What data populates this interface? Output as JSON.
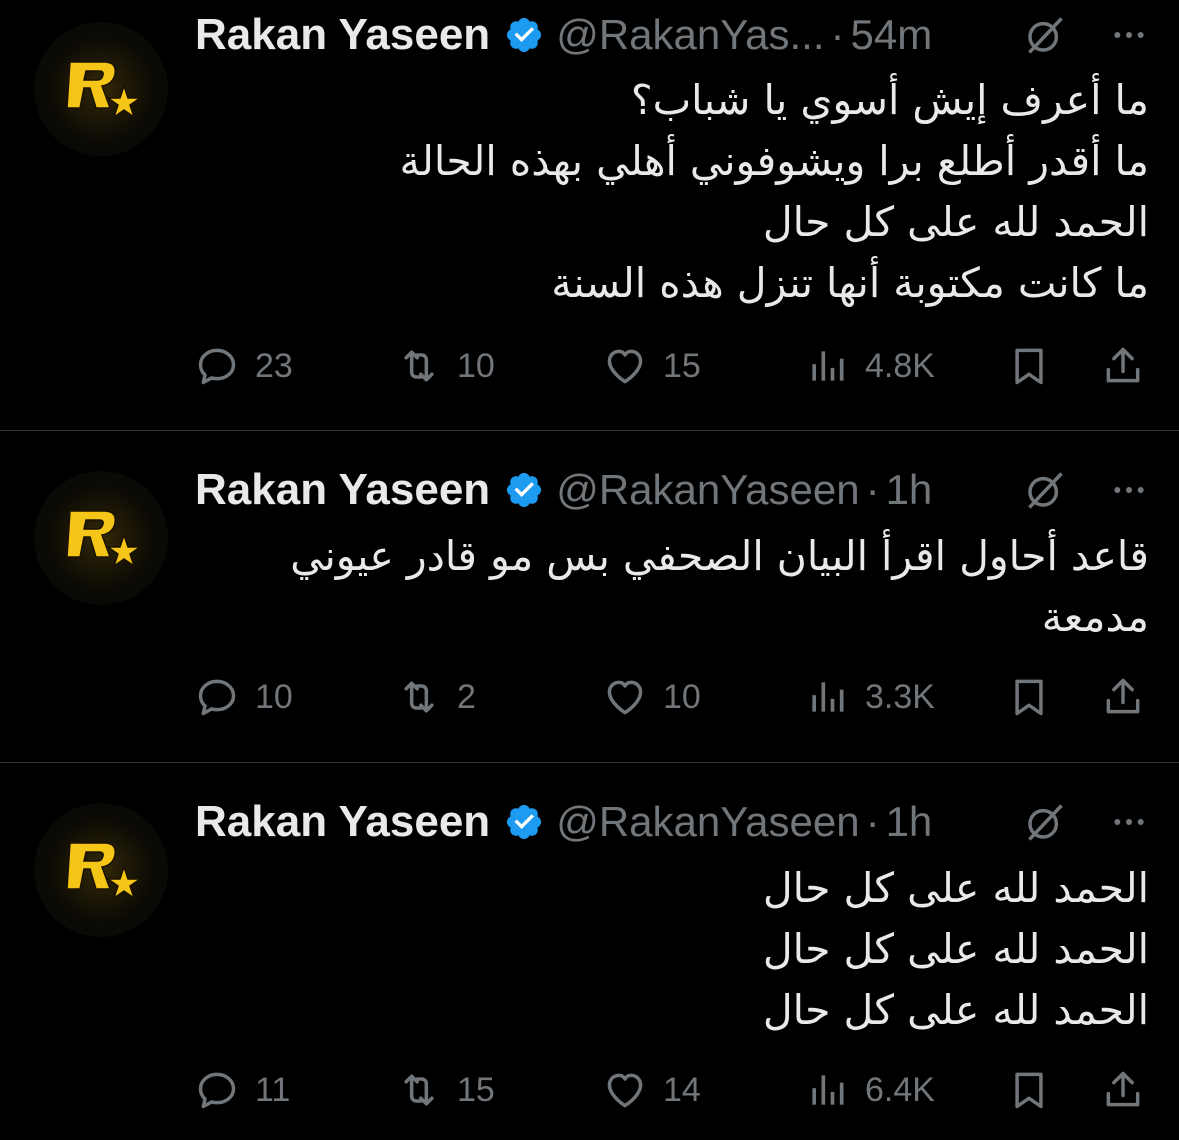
{
  "tweets": [
    {
      "author_name": "Rakan Yaseen",
      "handle": "@RakanYas...",
      "separator": "·",
      "time": "54m",
      "lines": [
        "ما أعرف إيش أسوي يا شباب؟",
        "ما أقدر أطلع برا ويشوفوني أهلي بهذه الحالة",
        "الحمد لله على كل حال",
        "ما كانت مكتوبة أنها تنزل هذه السنة"
      ],
      "replies": "23",
      "reposts": "10",
      "likes": "15",
      "views": "4.8K"
    },
    {
      "author_name": "Rakan Yaseen",
      "handle": "@RakanYaseen",
      "separator": "·",
      "time": "1h",
      "lines": [
        "قاعد أحاول اقرأ البيان الصحفي بس مو قادر عيوني",
        "مدمعة"
      ],
      "replies": "10",
      "reposts": "2",
      "likes": "10",
      "views": "3.3K"
    },
    {
      "author_name": "Rakan Yaseen",
      "handle": "@RakanYaseen",
      "separator": "·",
      "time": "1h",
      "lines": [
        "الحمد لله على كل حال",
        "الحمد لله على كل حال",
        "الحمد لله على كل حال"
      ],
      "replies": "11",
      "reposts": "15",
      "likes": "14",
      "views": "6.4K"
    }
  ],
  "icons": {
    "avatar": "rockstar-logo-icon",
    "verified": "verified-badge-icon",
    "grok": "grok-icon",
    "more": "more-icon",
    "reply": "reply-icon",
    "repost": "repost-icon",
    "like": "heart-icon",
    "views": "views-chart-icon",
    "bookmark": "bookmark-icon",
    "share": "share-icon"
  },
  "colors": {
    "background": "#000000",
    "text": "#e7e9ea",
    "muted": "#71767b",
    "verified": "#1d9bf0",
    "logo": "#f5c518",
    "divider": "#2f3336"
  }
}
